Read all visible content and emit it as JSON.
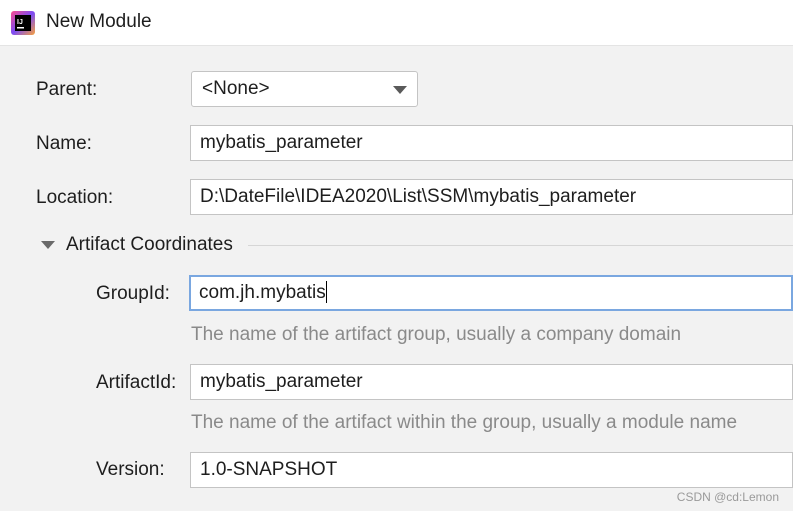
{
  "window": {
    "title": "New Module",
    "icon": "intellij-idea-icon"
  },
  "form": {
    "parent_label": "Parent:",
    "parent_value": "<None>",
    "name_label": "Name:",
    "name_value": "mybatis_parameter",
    "location_label": "Location:",
    "location_value": "D:\\DateFile\\IDEA2020\\List\\SSM\\mybatis_parameter"
  },
  "artifact": {
    "section_title": "Artifact Coordinates",
    "groupid_label": "GroupId:",
    "groupid_value": "com.jh.mybatis",
    "groupid_hint": "The name of the artifact group, usually a company domain",
    "artifactid_label": "ArtifactId:",
    "artifactid_value": "mybatis_parameter",
    "artifactid_hint": "The name of the artifact within the group, usually a module name",
    "version_label": "Version:",
    "version_value": "1.0-SNAPSHOT"
  },
  "watermark": "CSDN @cd:Lemon",
  "colors": {
    "background": "#f2f2f2",
    "focus_border": "#7aa7e0",
    "hint_text": "#8a8a8a"
  }
}
